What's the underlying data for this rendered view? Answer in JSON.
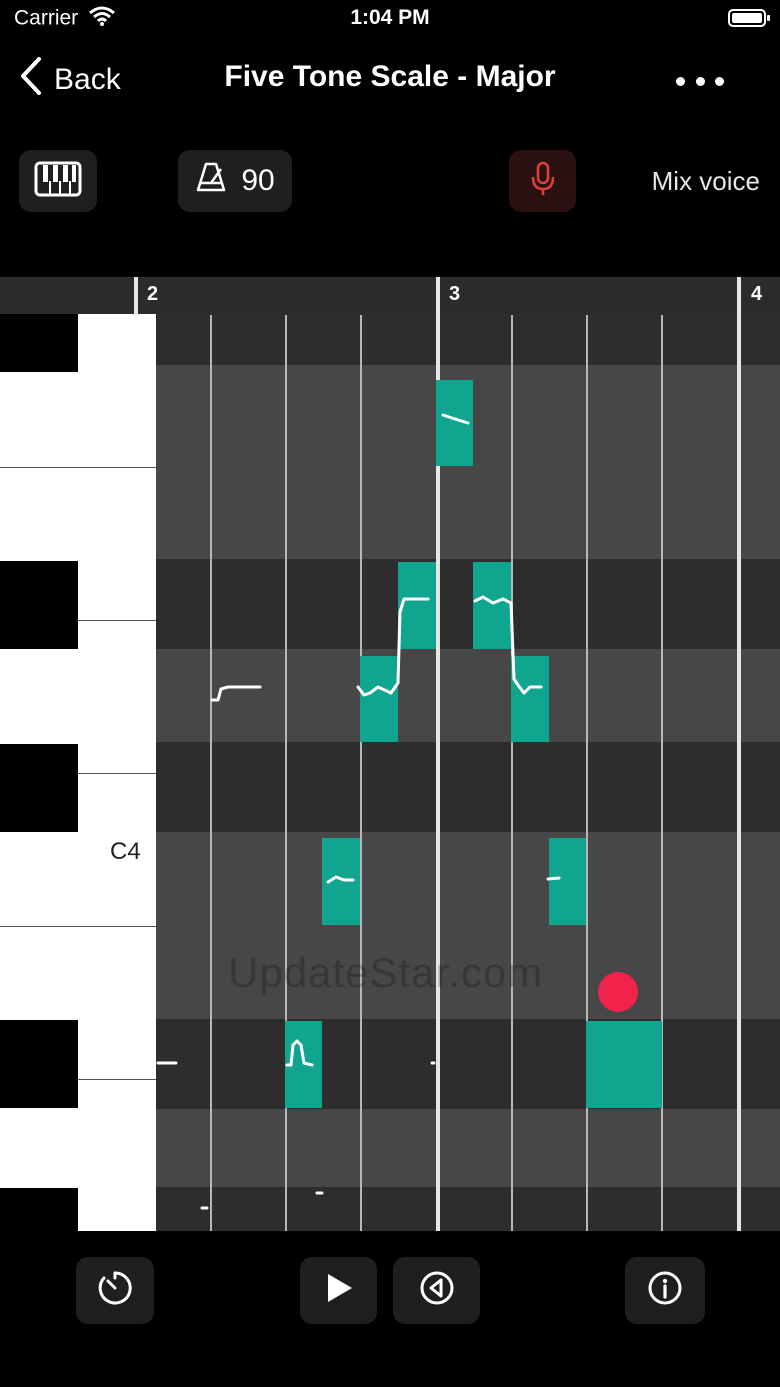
{
  "status_bar": {
    "carrier": "Carrier",
    "time": "1:04 PM"
  },
  "nav": {
    "back_label": "Back",
    "title": "Five Tone Scale - Major"
  },
  "toolbar": {
    "tempo": "90",
    "voice_mode": "Mix voice"
  },
  "roll": {
    "bar_numbers": [
      "2",
      "3",
      "4"
    ],
    "key_label": "C4",
    "watermark": "UpdateStar.com"
  },
  "colors": {
    "note": "#0fa58e",
    "record_dot": "#f0234b",
    "mic": "#e0403c"
  },
  "icons": [
    "piano-icon",
    "metronome-icon",
    "microphone-icon",
    "more-icon",
    "timer-icon",
    "play-icon",
    "rewind-icon",
    "info-icon"
  ]
}
